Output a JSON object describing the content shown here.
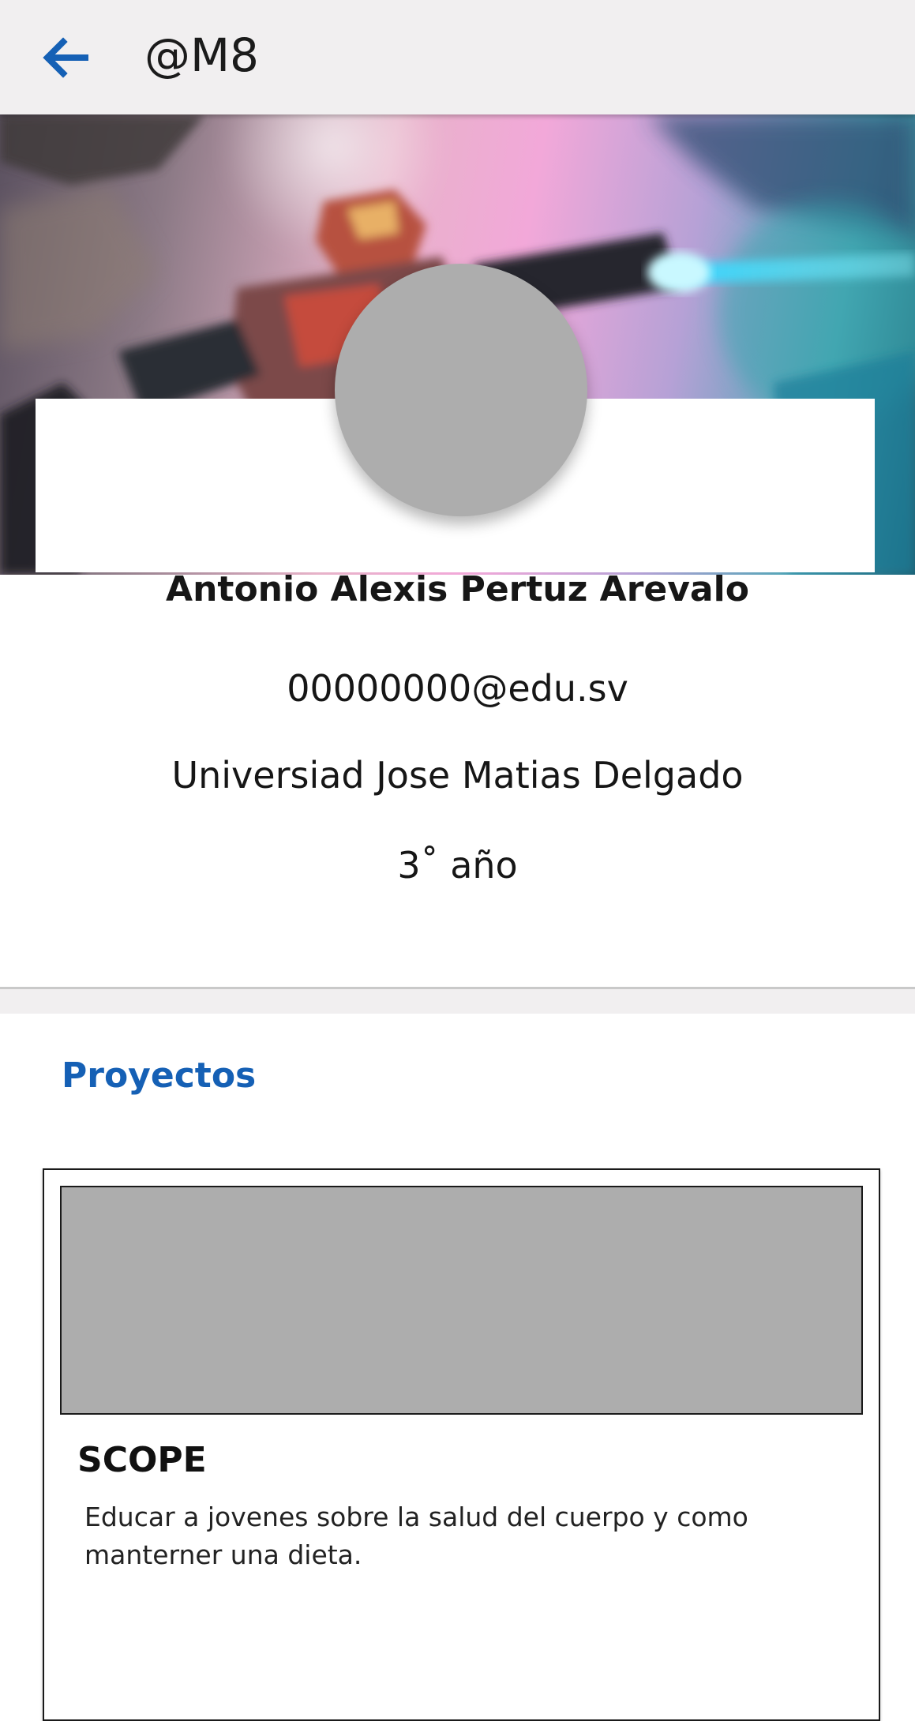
{
  "appbar": {
    "back_icon": "arrow-left-icon",
    "title": "@M8",
    "accent_color": "#1560b5"
  },
  "profile": {
    "name": "Antonio Alexis Pertuz Arevalo",
    "email": "00000000@edu.sv",
    "university": "Universiad Jose Matias Delgado",
    "year": "3˚ año"
  },
  "projects": {
    "section_title": "Proyectos",
    "items": [
      {
        "name": "SCOPE",
        "description": "Educar a jovenes sobre la salud del cuerpo y como manterner una dieta."
      }
    ]
  }
}
